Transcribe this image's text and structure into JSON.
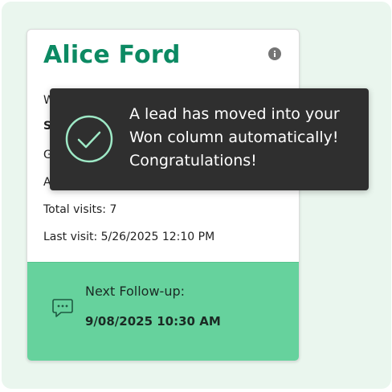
{
  "lead_card": {
    "name": "Alice Ford",
    "info_icon": "info-icon",
    "details": [
      {
        "text": "W"
      },
      {
        "text": "S"
      },
      {
        "text": "G"
      },
      {
        "text": "A"
      },
      {
        "text": "Total visits: 7"
      },
      {
        "text": "Last visit: 5/26/2025 12:10 PM"
      }
    ],
    "follow_up": {
      "icon": "chat-bubble-icon",
      "label": "Next Follow-up:",
      "date": "9/08/2025 10:30 AM"
    }
  },
  "toast": {
    "icon": "check-circle-icon",
    "lines": [
      "A lead has moved into your",
      "Won column automatically!",
      "Congratulations!"
    ]
  },
  "colors": {
    "page_background": "#eaf6ee",
    "title_green": "#0c8a63",
    "follow_up_background": "#66d29d",
    "toast_background": "#2f2f2f",
    "check_accent": "#9ee9c6"
  }
}
